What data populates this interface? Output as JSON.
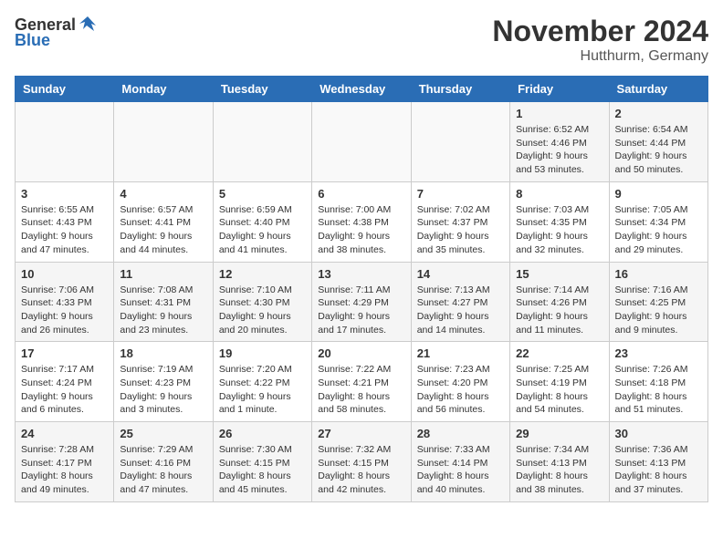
{
  "logo": {
    "general": "General",
    "blue": "Blue"
  },
  "title": "November 2024",
  "location": "Hutthurm, Germany",
  "days_of_week": [
    "Sunday",
    "Monday",
    "Tuesday",
    "Wednesday",
    "Thursday",
    "Friday",
    "Saturday"
  ],
  "weeks": [
    [
      {
        "day": "",
        "info": ""
      },
      {
        "day": "",
        "info": ""
      },
      {
        "day": "",
        "info": ""
      },
      {
        "day": "",
        "info": ""
      },
      {
        "day": "",
        "info": ""
      },
      {
        "day": "1",
        "info": "Sunrise: 6:52 AM\nSunset: 4:46 PM\nDaylight: 9 hours\nand 53 minutes."
      },
      {
        "day": "2",
        "info": "Sunrise: 6:54 AM\nSunset: 4:44 PM\nDaylight: 9 hours\nand 50 minutes."
      }
    ],
    [
      {
        "day": "3",
        "info": "Sunrise: 6:55 AM\nSunset: 4:43 PM\nDaylight: 9 hours\nand 47 minutes."
      },
      {
        "day": "4",
        "info": "Sunrise: 6:57 AM\nSunset: 4:41 PM\nDaylight: 9 hours\nand 44 minutes."
      },
      {
        "day": "5",
        "info": "Sunrise: 6:59 AM\nSunset: 4:40 PM\nDaylight: 9 hours\nand 41 minutes."
      },
      {
        "day": "6",
        "info": "Sunrise: 7:00 AM\nSunset: 4:38 PM\nDaylight: 9 hours\nand 38 minutes."
      },
      {
        "day": "7",
        "info": "Sunrise: 7:02 AM\nSunset: 4:37 PM\nDaylight: 9 hours\nand 35 minutes."
      },
      {
        "day": "8",
        "info": "Sunrise: 7:03 AM\nSunset: 4:35 PM\nDaylight: 9 hours\nand 32 minutes."
      },
      {
        "day": "9",
        "info": "Sunrise: 7:05 AM\nSunset: 4:34 PM\nDaylight: 9 hours\nand 29 minutes."
      }
    ],
    [
      {
        "day": "10",
        "info": "Sunrise: 7:06 AM\nSunset: 4:33 PM\nDaylight: 9 hours\nand 26 minutes."
      },
      {
        "day": "11",
        "info": "Sunrise: 7:08 AM\nSunset: 4:31 PM\nDaylight: 9 hours\nand 23 minutes."
      },
      {
        "day": "12",
        "info": "Sunrise: 7:10 AM\nSunset: 4:30 PM\nDaylight: 9 hours\nand 20 minutes."
      },
      {
        "day": "13",
        "info": "Sunrise: 7:11 AM\nSunset: 4:29 PM\nDaylight: 9 hours\nand 17 minutes."
      },
      {
        "day": "14",
        "info": "Sunrise: 7:13 AM\nSunset: 4:27 PM\nDaylight: 9 hours\nand 14 minutes."
      },
      {
        "day": "15",
        "info": "Sunrise: 7:14 AM\nSunset: 4:26 PM\nDaylight: 9 hours\nand 11 minutes."
      },
      {
        "day": "16",
        "info": "Sunrise: 7:16 AM\nSunset: 4:25 PM\nDaylight: 9 hours\nand 9 minutes."
      }
    ],
    [
      {
        "day": "17",
        "info": "Sunrise: 7:17 AM\nSunset: 4:24 PM\nDaylight: 9 hours\nand 6 minutes."
      },
      {
        "day": "18",
        "info": "Sunrise: 7:19 AM\nSunset: 4:23 PM\nDaylight: 9 hours\nand 3 minutes."
      },
      {
        "day": "19",
        "info": "Sunrise: 7:20 AM\nSunset: 4:22 PM\nDaylight: 9 hours\nand 1 minute."
      },
      {
        "day": "20",
        "info": "Sunrise: 7:22 AM\nSunset: 4:21 PM\nDaylight: 8 hours\nand 58 minutes."
      },
      {
        "day": "21",
        "info": "Sunrise: 7:23 AM\nSunset: 4:20 PM\nDaylight: 8 hours\nand 56 minutes."
      },
      {
        "day": "22",
        "info": "Sunrise: 7:25 AM\nSunset: 4:19 PM\nDaylight: 8 hours\nand 54 minutes."
      },
      {
        "day": "23",
        "info": "Sunrise: 7:26 AM\nSunset: 4:18 PM\nDaylight: 8 hours\nand 51 minutes."
      }
    ],
    [
      {
        "day": "24",
        "info": "Sunrise: 7:28 AM\nSunset: 4:17 PM\nDaylight: 8 hours\nand 49 minutes."
      },
      {
        "day": "25",
        "info": "Sunrise: 7:29 AM\nSunset: 4:16 PM\nDaylight: 8 hours\nand 47 minutes."
      },
      {
        "day": "26",
        "info": "Sunrise: 7:30 AM\nSunset: 4:15 PM\nDaylight: 8 hours\nand 45 minutes."
      },
      {
        "day": "27",
        "info": "Sunrise: 7:32 AM\nSunset: 4:15 PM\nDaylight: 8 hours\nand 42 minutes."
      },
      {
        "day": "28",
        "info": "Sunrise: 7:33 AM\nSunset: 4:14 PM\nDaylight: 8 hours\nand 40 minutes."
      },
      {
        "day": "29",
        "info": "Sunrise: 7:34 AM\nSunset: 4:13 PM\nDaylight: 8 hours\nand 38 minutes."
      },
      {
        "day": "30",
        "info": "Sunrise: 7:36 AM\nSunset: 4:13 PM\nDaylight: 8 hours\nand 37 minutes."
      }
    ]
  ]
}
